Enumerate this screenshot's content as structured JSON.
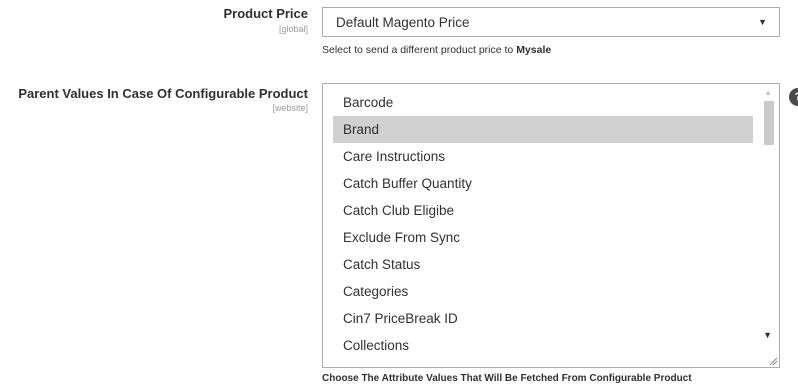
{
  "product_price": {
    "label": "Product Price",
    "scope": "[global]",
    "selected": "Default Magento Price",
    "note_prefix": "Select to send a different product price to ",
    "note_bold": "Mysale"
  },
  "parent_values": {
    "label": "Parent Values In Case Of Configurable Product",
    "scope": "[website]",
    "options": [
      "Barcode",
      "Brand",
      "Care Instructions",
      "Catch Buffer Quantity",
      "Catch Club Eligibe",
      "Exclude From Sync",
      "Catch Status",
      "Categories",
      "Cin7 PriceBreak ID",
      "Collections"
    ],
    "selected_option": "Brand",
    "note": "Choose The Attribute Values That Will Be Fetched From Configurable Product"
  },
  "icons": {
    "dropdown": "chevron-down-icon",
    "help": "question-mark-icon",
    "scroll_up": "scroll-up-arrow-icon",
    "scroll_down": "scroll-down-arrow-icon",
    "resize": "resize-grip-icon"
  },
  "colors": {
    "selected_option_bg": "#d0d0d0",
    "border": "#adadad"
  }
}
